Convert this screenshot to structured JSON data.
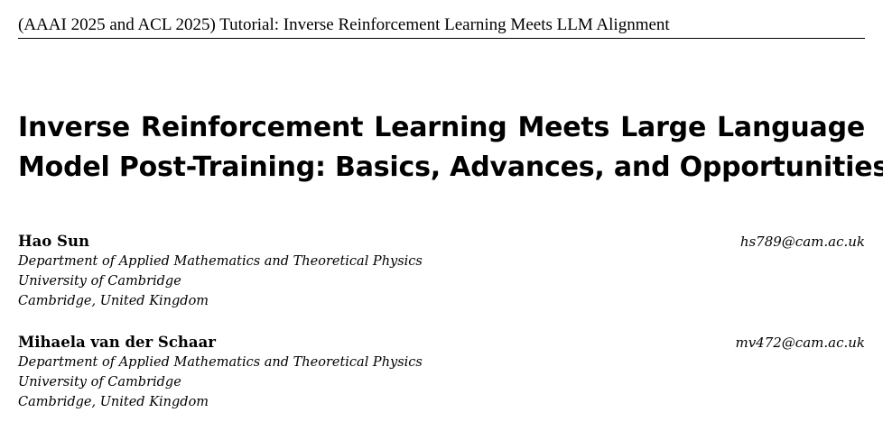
{
  "running_header": "(AAAI 2025 and ACL 2025) Tutorial: Inverse Reinforcement Learning Meets LLM Alignment",
  "title": {
    "line1_words": [
      "Inverse",
      "Reinforcement",
      "Learning",
      "Meets",
      "Large",
      "Language"
    ],
    "line2": "Model Post-Training: Basics, Advances, and Opportunities"
  },
  "authors": [
    {
      "name": "Hao Sun",
      "email": "hs789@cam.ac.uk",
      "affiliation": [
        "Department of Applied Mathematics and Theoretical Physics",
        "University of Cambridge",
        "Cambridge, United Kingdom"
      ]
    },
    {
      "name": "Mihaela van der Schaar",
      "email": "mv472@cam.ac.uk",
      "affiliation": [
        "Department of Applied Mathematics and Theoretical Physics",
        "University of Cambridge",
        "Cambridge, United Kingdom"
      ]
    }
  ]
}
